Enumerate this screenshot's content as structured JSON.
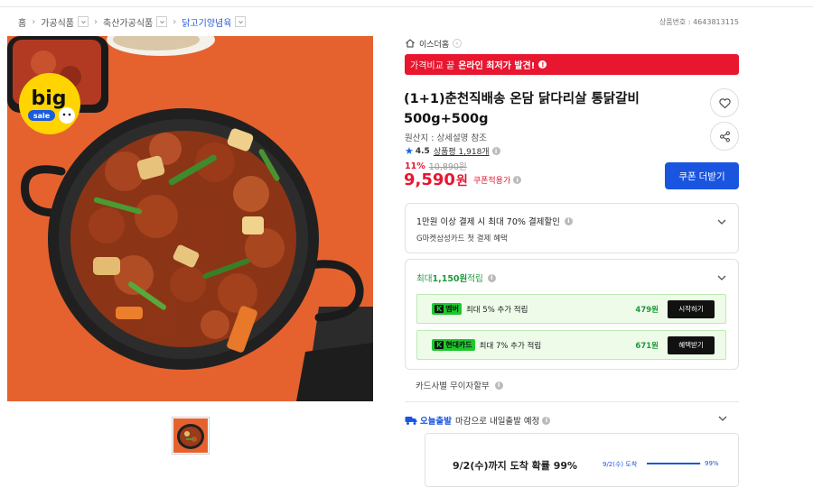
{
  "breadcrumb": [
    {
      "label": "홈"
    },
    {
      "label": "가공식품"
    },
    {
      "label": "축산가공식품"
    },
    {
      "label": "닭고기양념육"
    }
  ],
  "product_no": "상품번호 : 4643813115",
  "badge": {
    "big": "big",
    "sale": "sale"
  },
  "store": {
    "name": "이스더홈"
  },
  "price_banner": {
    "prefix": "가격비교 끝",
    "strong": "온라인 최저가 발견!"
  },
  "product": {
    "title": "(1+1)춘천직배송 온담 닭다리살 통닭갈비 500g+500g",
    "origin": "원산지 : 상세설명 참조",
    "rating": "4.5",
    "review_label": "상품평 1,918개"
  },
  "price": {
    "discount_rate": "11%",
    "original": "10,890원",
    "final": "9,590",
    "unit": "원",
    "coupon_note": "쿠폰적용가",
    "coupon_button": "쿠폰 더받기"
  },
  "payment": {
    "title": "1만원 이상 결제 시 최대 70% 결제할인",
    "subtitle": "G마켓삼성카드 첫 결제 혜택"
  },
  "points": {
    "title_prefix": "최대 ",
    "title_amount": "1,150원",
    "title_suffix": " 적립",
    "rows": [
      {
        "tag_k": "K",
        "tag": "멤버",
        "text": "최대 5% 추가 적립",
        "amount": "479원",
        "button": "시작하기"
      },
      {
        "tag_k": "K",
        "tag": "현대카드",
        "text": "최대 7% 추가 적립",
        "amount": "671원",
        "button": "혜택받기"
      }
    ]
  },
  "installment": "카드사별 무이자할부",
  "delivery": {
    "brand": "오늘출발",
    "text": "마감으로 내일출발 예정",
    "eta_main": "9/2(수)까지 도착 확률 99%",
    "eta_label": "9/2(수) 도착",
    "eta_percent_text": "99%",
    "eta_fraction": 0.99
  },
  "colors": {
    "accent_red": "#e8162f",
    "accent_blue": "#1a55e0",
    "points_green": "#1f9a3c"
  }
}
